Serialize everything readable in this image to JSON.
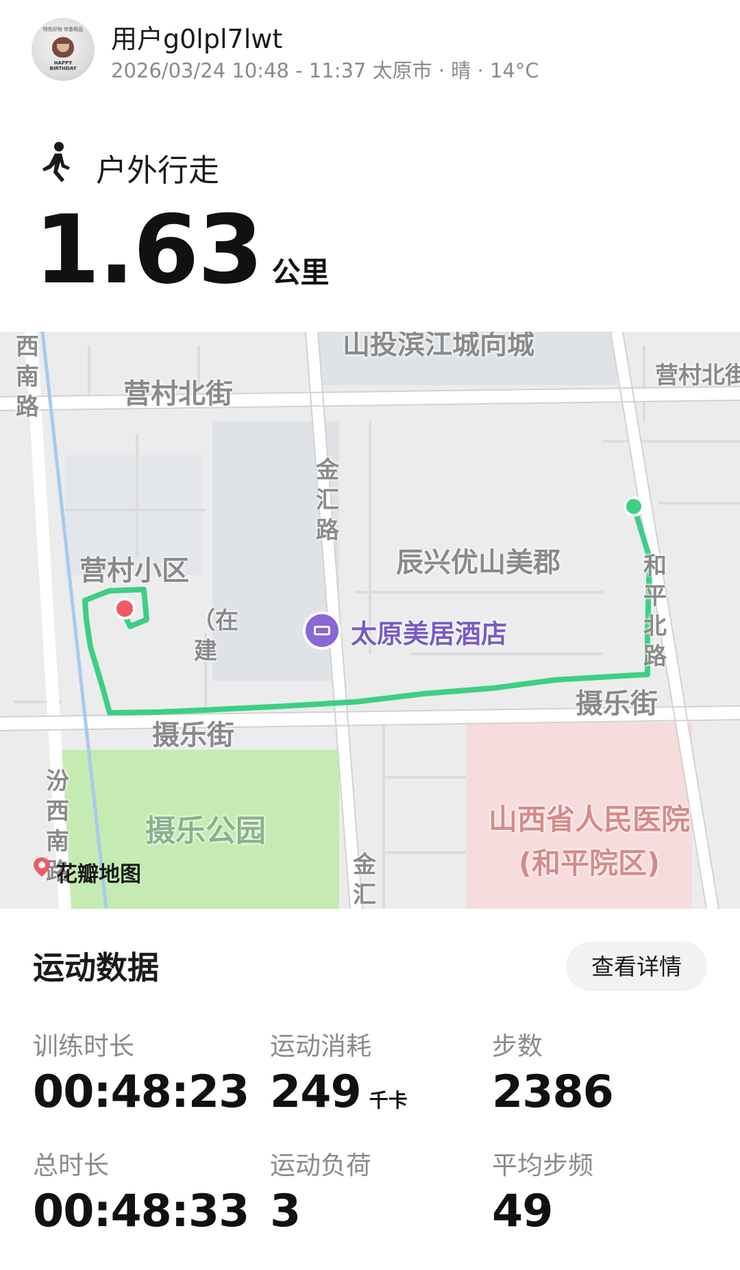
{
  "header": {
    "username": "用户g0lpl7lwt",
    "meta": "2026/03/24 10:48 - 11:37 太原市 · 晴 · 14°C",
    "avatar": {
      "top_text": "特色好物 常备精品",
      "bottom_text": "HAPPY BIRTHDAY"
    }
  },
  "activity": {
    "icon": "walking-person-icon",
    "title": "户外行走",
    "distance": "1.63",
    "unit": "公里"
  },
  "map": {
    "labels": {
      "north_complex": "山投滨江城向城",
      "yingcun_north_st_west": "营村北街",
      "yingcun_north_st_east": "营村北街",
      "xinan_rd": "西南路",
      "jinhui_rd": "金汇路",
      "jinhui_rd_south": "金汇",
      "chenxing": "辰兴优山美郡",
      "heping_north_rd": "和平北路",
      "yingcun_community": "营村小区",
      "under_construction": "（在建",
      "hotel": "太原美居酒店",
      "shele_st_west": "摄乐街",
      "shele_st_east": "摄乐街",
      "fenxinan_rd": "汾西南路",
      "shele_park": "摄乐公园",
      "hospital_line1": "山西省人民医院",
      "hospital_line2": "(和平院区)"
    },
    "brand": "花瓣地图",
    "colors": {
      "route": "#3ecf86",
      "start": "#3ecf86",
      "end": "#ee5a66",
      "park": "#c5ebb2",
      "hospital": "#f6dcdc"
    }
  },
  "stats": {
    "section_title": "运动数据",
    "detail_button": "查看详情",
    "training_time": {
      "label": "训练时长",
      "value": "00:48:23"
    },
    "calories": {
      "label": "运动消耗",
      "value": "249",
      "unit": "千卡"
    },
    "steps": {
      "label": "步数",
      "value": "2386"
    },
    "total_time": {
      "label": "总时长",
      "value": "00:48:33"
    },
    "load": {
      "label": "运动负荷",
      "value": "3"
    },
    "cadence": {
      "label": "平均步频",
      "value": "49"
    }
  }
}
